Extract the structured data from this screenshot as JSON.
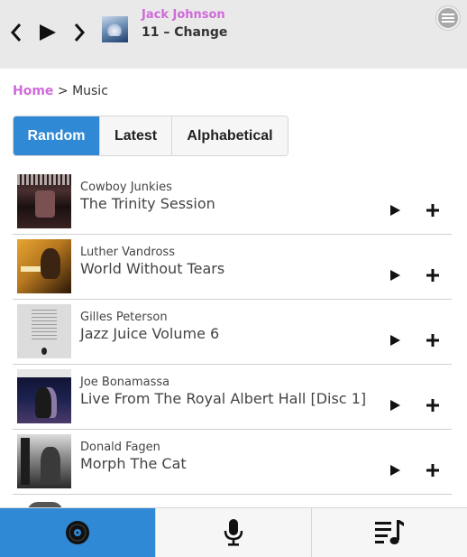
{
  "now_playing": {
    "artist": "Jack Johnson",
    "track": "11 – Change",
    "icons": {
      "prev": "chevron-left-icon",
      "play": "play-icon",
      "next": "chevron-right-icon",
      "menu": "menu-icon"
    }
  },
  "breadcrumb": {
    "home": "Home",
    "separator": ">",
    "current": "Music"
  },
  "sort_tabs": [
    {
      "label": "Random",
      "active": true
    },
    {
      "label": "Latest",
      "active": false
    },
    {
      "label": "Alphabetical",
      "active": false
    }
  ],
  "albums": [
    {
      "artist": "Cowboy Junkies",
      "title": "The Trinity Session"
    },
    {
      "artist": "Luther Vandross",
      "title": "World Without Tears"
    },
    {
      "artist": "Gilles Peterson",
      "title": "Jazz Juice Volume 6"
    },
    {
      "artist": "Joe Bonamassa",
      "title": "Live From The Royal Albert Hall [Disc 1]"
    },
    {
      "artist": "Donald Fagen",
      "title": "Morph The Cat"
    }
  ],
  "bottom_nav": [
    {
      "icon": "vinyl-record-icon",
      "active": true
    },
    {
      "icon": "microphone-icon",
      "active": false
    },
    {
      "icon": "playlist-icon",
      "active": false
    }
  ],
  "colors": {
    "accent": "#3089d4",
    "link": "#cf6ad9",
    "header_bg": "#e9e9e9"
  }
}
